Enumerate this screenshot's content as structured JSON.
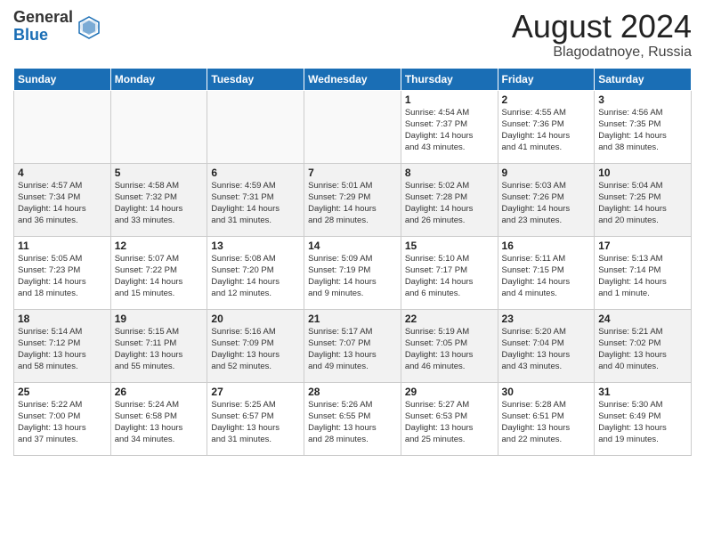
{
  "header": {
    "logo_general": "General",
    "logo_blue": "Blue",
    "month_title": "August 2024",
    "location": "Blagodatnoye, Russia"
  },
  "weekdays": [
    "Sunday",
    "Monday",
    "Tuesday",
    "Wednesday",
    "Thursday",
    "Friday",
    "Saturday"
  ],
  "weeks": [
    [
      {
        "day": "",
        "info": ""
      },
      {
        "day": "",
        "info": ""
      },
      {
        "day": "",
        "info": ""
      },
      {
        "day": "",
        "info": ""
      },
      {
        "day": "1",
        "info": "Sunrise: 4:54 AM\nSunset: 7:37 PM\nDaylight: 14 hours\nand 43 minutes."
      },
      {
        "day": "2",
        "info": "Sunrise: 4:55 AM\nSunset: 7:36 PM\nDaylight: 14 hours\nand 41 minutes."
      },
      {
        "day": "3",
        "info": "Sunrise: 4:56 AM\nSunset: 7:35 PM\nDaylight: 14 hours\nand 38 minutes."
      }
    ],
    [
      {
        "day": "4",
        "info": "Sunrise: 4:57 AM\nSunset: 7:34 PM\nDaylight: 14 hours\nand 36 minutes."
      },
      {
        "day": "5",
        "info": "Sunrise: 4:58 AM\nSunset: 7:32 PM\nDaylight: 14 hours\nand 33 minutes."
      },
      {
        "day": "6",
        "info": "Sunrise: 4:59 AM\nSunset: 7:31 PM\nDaylight: 14 hours\nand 31 minutes."
      },
      {
        "day": "7",
        "info": "Sunrise: 5:01 AM\nSunset: 7:29 PM\nDaylight: 14 hours\nand 28 minutes."
      },
      {
        "day": "8",
        "info": "Sunrise: 5:02 AM\nSunset: 7:28 PM\nDaylight: 14 hours\nand 26 minutes."
      },
      {
        "day": "9",
        "info": "Sunrise: 5:03 AM\nSunset: 7:26 PM\nDaylight: 14 hours\nand 23 minutes."
      },
      {
        "day": "10",
        "info": "Sunrise: 5:04 AM\nSunset: 7:25 PM\nDaylight: 14 hours\nand 20 minutes."
      }
    ],
    [
      {
        "day": "11",
        "info": "Sunrise: 5:05 AM\nSunset: 7:23 PM\nDaylight: 14 hours\nand 18 minutes."
      },
      {
        "day": "12",
        "info": "Sunrise: 5:07 AM\nSunset: 7:22 PM\nDaylight: 14 hours\nand 15 minutes."
      },
      {
        "day": "13",
        "info": "Sunrise: 5:08 AM\nSunset: 7:20 PM\nDaylight: 14 hours\nand 12 minutes."
      },
      {
        "day": "14",
        "info": "Sunrise: 5:09 AM\nSunset: 7:19 PM\nDaylight: 14 hours\nand 9 minutes."
      },
      {
        "day": "15",
        "info": "Sunrise: 5:10 AM\nSunset: 7:17 PM\nDaylight: 14 hours\nand 6 minutes."
      },
      {
        "day": "16",
        "info": "Sunrise: 5:11 AM\nSunset: 7:15 PM\nDaylight: 14 hours\nand 4 minutes."
      },
      {
        "day": "17",
        "info": "Sunrise: 5:13 AM\nSunset: 7:14 PM\nDaylight: 14 hours\nand 1 minute."
      }
    ],
    [
      {
        "day": "18",
        "info": "Sunrise: 5:14 AM\nSunset: 7:12 PM\nDaylight: 13 hours\nand 58 minutes."
      },
      {
        "day": "19",
        "info": "Sunrise: 5:15 AM\nSunset: 7:11 PM\nDaylight: 13 hours\nand 55 minutes."
      },
      {
        "day": "20",
        "info": "Sunrise: 5:16 AM\nSunset: 7:09 PM\nDaylight: 13 hours\nand 52 minutes."
      },
      {
        "day": "21",
        "info": "Sunrise: 5:17 AM\nSunset: 7:07 PM\nDaylight: 13 hours\nand 49 minutes."
      },
      {
        "day": "22",
        "info": "Sunrise: 5:19 AM\nSunset: 7:05 PM\nDaylight: 13 hours\nand 46 minutes."
      },
      {
        "day": "23",
        "info": "Sunrise: 5:20 AM\nSunset: 7:04 PM\nDaylight: 13 hours\nand 43 minutes."
      },
      {
        "day": "24",
        "info": "Sunrise: 5:21 AM\nSunset: 7:02 PM\nDaylight: 13 hours\nand 40 minutes."
      }
    ],
    [
      {
        "day": "25",
        "info": "Sunrise: 5:22 AM\nSunset: 7:00 PM\nDaylight: 13 hours\nand 37 minutes."
      },
      {
        "day": "26",
        "info": "Sunrise: 5:24 AM\nSunset: 6:58 PM\nDaylight: 13 hours\nand 34 minutes."
      },
      {
        "day": "27",
        "info": "Sunrise: 5:25 AM\nSunset: 6:57 PM\nDaylight: 13 hours\nand 31 minutes."
      },
      {
        "day": "28",
        "info": "Sunrise: 5:26 AM\nSunset: 6:55 PM\nDaylight: 13 hours\nand 28 minutes."
      },
      {
        "day": "29",
        "info": "Sunrise: 5:27 AM\nSunset: 6:53 PM\nDaylight: 13 hours\nand 25 minutes."
      },
      {
        "day": "30",
        "info": "Sunrise: 5:28 AM\nSunset: 6:51 PM\nDaylight: 13 hours\nand 22 minutes."
      },
      {
        "day": "31",
        "info": "Sunrise: 5:30 AM\nSunset: 6:49 PM\nDaylight: 13 hours\nand 19 minutes."
      }
    ]
  ]
}
